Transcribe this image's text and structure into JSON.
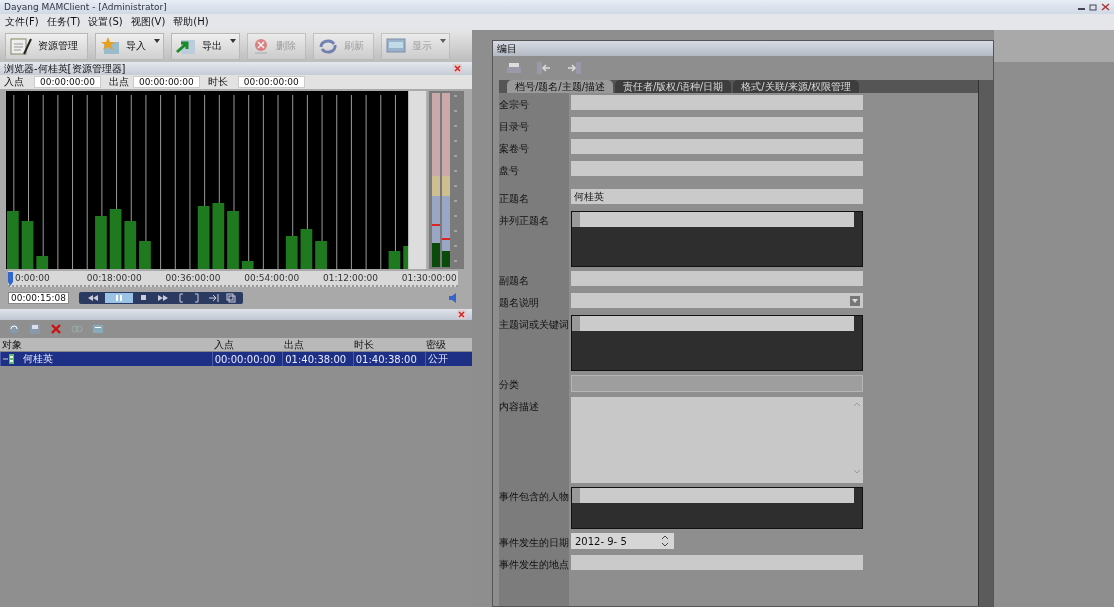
{
  "window": {
    "title": "Dayang MAMClient - [Administrator]"
  },
  "menu": [
    "文件(F)",
    "任务(T)",
    "设置(S)",
    "视图(V)",
    "帮助(H)"
  ],
  "toolbar": [
    {
      "label": "资源管理",
      "disabled": false,
      "dropdown": false
    },
    {
      "label": "导入",
      "disabled": false,
      "dropdown": true
    },
    {
      "label": "导出",
      "disabled": false,
      "dropdown": true
    },
    {
      "label": "删除",
      "disabled": true,
      "dropdown": false
    },
    {
      "label": "刷新",
      "disabled": true,
      "dropdown": false
    },
    {
      "label": "显示",
      "disabled": true,
      "dropdown": true
    }
  ],
  "browser": {
    "title": "浏览器-何桂英[资源管理器]",
    "in_label": "入点",
    "in_value": "00:00:00:00",
    "out_label": "出点",
    "out_value": "00:00:00:00",
    "duration_label": "时长",
    "duration_value": "00:00:00:00",
    "timeline_ticks": [
      "0:00:00",
      "00:18:00:00",
      "00:36:00:00",
      "00:54:00:00",
      "01:12:00:00",
      "01:30:00:00"
    ],
    "current_time": "00:00:15:08"
  },
  "clip_list": {
    "columns": [
      "对象",
      "入点",
      "出点",
      "时长",
      "密级"
    ],
    "rows": [
      {
        "selected": true,
        "cells": [
          "何桂英",
          "00:00:00:00",
          "01:40:38:00",
          "01:40:38:00",
          "公开"
        ]
      }
    ]
  },
  "catalog": {
    "title": "编目",
    "tabs": [
      {
        "label": "档号/题名/主题/描述",
        "selected": true
      },
      {
        "label": "责任者/版权/语种/日期",
        "selected": false
      },
      {
        "label": "格式/关联/来源/权限管理",
        "selected": false
      }
    ],
    "fields": [
      {
        "label": "全宗号",
        "kind": "text",
        "disabled": false
      },
      {
        "label": "目录号",
        "kind": "text",
        "disabled": false
      },
      {
        "label": "案卷号",
        "kind": "text",
        "disabled": false
      },
      {
        "label": "盘号",
        "kind": "text",
        "disabled": false
      },
      {
        "label": "正题名",
        "kind": "text",
        "value": "何桂英",
        "disabled": false
      },
      {
        "label": "并列正题名",
        "kind": "list",
        "disabled": false
      },
      {
        "label": "副题名",
        "kind": "text",
        "disabled": false
      },
      {
        "label": "题名说明",
        "kind": "dropdown",
        "disabled": false
      },
      {
        "label": "主题词或关键词",
        "kind": "list",
        "disabled": false
      },
      {
        "label": "分类",
        "kind": "text",
        "disabled": true
      },
      {
        "label": "内容描述",
        "kind": "memo",
        "disabled": false
      },
      {
        "label": "事件包含的人物",
        "kind": "list",
        "disabled": false
      },
      {
        "label": "事件发生的日期",
        "kind": "date",
        "value": "2012- 9- 5",
        "disabled": false
      },
      {
        "label": "事件发生的地点",
        "kind": "text",
        "disabled": false
      }
    ]
  }
}
